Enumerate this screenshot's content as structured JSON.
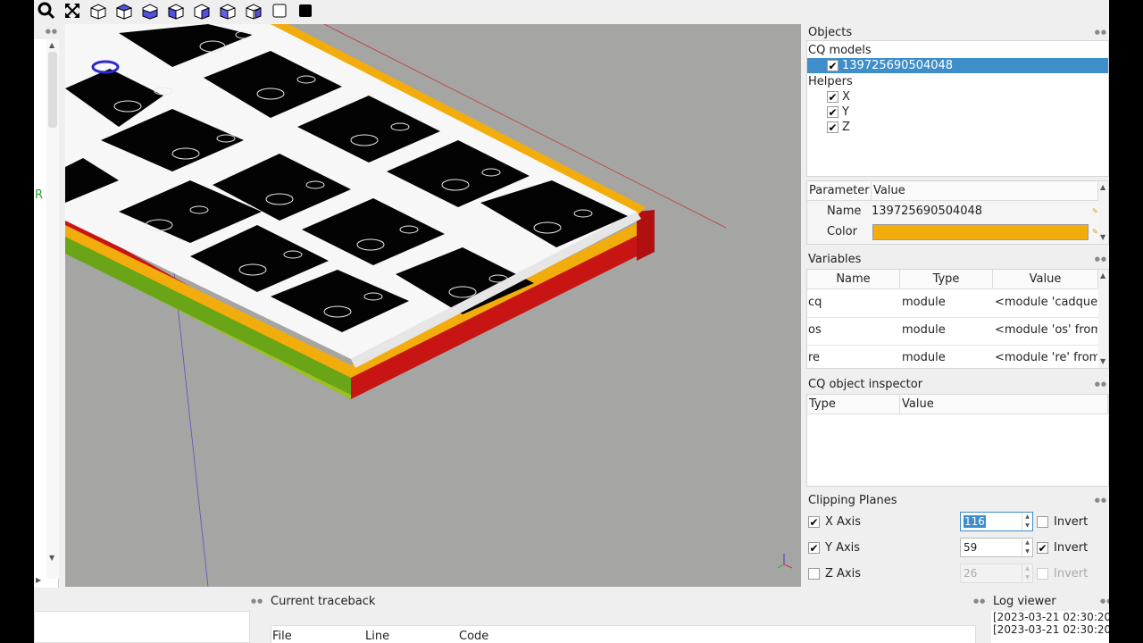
{
  "toolbar": {
    "icons": [
      "zoom-icon",
      "fit-icon",
      "view-iso-icon",
      "view-top-icon",
      "view-bottom-icon",
      "view-front-icon",
      "view-back-icon",
      "view-left-icon",
      "view-right-icon",
      "wireframe-icon",
      "shaded-icon"
    ]
  },
  "left_strip": {
    "label": "R"
  },
  "objects": {
    "title": "Objects",
    "groups": [
      {
        "label": "CQ models",
        "items": [
          {
            "label": "139725690504048",
            "checked": true,
            "selected": true
          }
        ]
      },
      {
        "label": "Helpers",
        "items": [
          {
            "label": "X",
            "checked": true
          },
          {
            "label": "Y",
            "checked": true
          },
          {
            "label": "Z",
            "checked": true
          }
        ]
      }
    ]
  },
  "parameters": {
    "headers": [
      "Parameter",
      "Value"
    ],
    "rows": [
      {
        "name": "Name",
        "value": "139725690504048"
      },
      {
        "name": "Color",
        "value": "",
        "color": "#f2ad0d"
      }
    ]
  },
  "variables": {
    "title": "Variables",
    "headers": [
      "Name",
      "Type",
      "Value"
    ],
    "rows": [
      {
        "name": "cq",
        "type": "module",
        "value": "<module 'cadquer..."
      },
      {
        "name": "os",
        "type": "module",
        "value": "<module 'os' from..."
      },
      {
        "name": "re",
        "type": "module",
        "value": "<module 're' from..."
      }
    ]
  },
  "inspector": {
    "title": "CQ object inspector",
    "headers": [
      "Type",
      "Value"
    ]
  },
  "clipping": {
    "title": "Clipping Planes",
    "axes": [
      {
        "label": "X Axis",
        "checked": true,
        "value": "116",
        "invert": "Invert",
        "invert_checked": false,
        "enabled": true
      },
      {
        "label": "Y Axis",
        "checked": true,
        "value": "59",
        "invert": "Invert",
        "invert_checked": true,
        "enabled": true
      },
      {
        "label": "Z Axis",
        "checked": false,
        "value": "26",
        "invert": "Invert",
        "invert_checked": false,
        "enabled": false
      }
    ]
  },
  "traceback": {
    "title": "Current traceback",
    "headers": [
      "File",
      "Line",
      "Code"
    ]
  },
  "log": {
    "title": "Log viewer",
    "entries": [
      "[2023-03-21 02:30:20",
      "[2023-03-21 02:30:20"
    ]
  }
}
